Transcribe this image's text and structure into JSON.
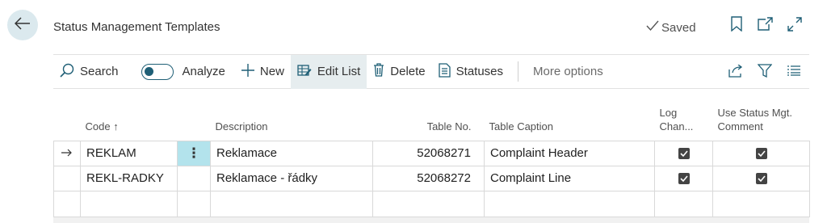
{
  "header": {
    "title": "Status Management Templates",
    "saved_label": "Saved"
  },
  "toolbar": {
    "search_label": "Search",
    "analyze_label": "Analyze",
    "analyze_on": false,
    "new_label": "New",
    "edit_list_label": "Edit List",
    "delete_label": "Delete",
    "statuses_label": "Statuses",
    "more_options_label": "More options"
  },
  "table": {
    "columns": {
      "code": "Code",
      "description": "Description",
      "table_no": "Table No.",
      "table_caption": "Table Caption",
      "log_changes": "Log Chan...",
      "use_status_1": "Use Status Mgt.",
      "use_status_2": "Comment"
    },
    "sort_indicator": "↑",
    "rows": [
      {
        "code": "REKLAM",
        "description": "Reklamace",
        "table_no": "52068271",
        "table_caption": "Complaint Header",
        "log_changes": true,
        "use_status_comment": true,
        "selected": true
      },
      {
        "code": "REKL-RADKY",
        "description": "Reklamace - řádky",
        "table_no": "52068272",
        "table_caption": "Complaint Line",
        "log_changes": true,
        "use_status_comment": true,
        "selected": false
      }
    ]
  },
  "colors": {
    "accent": "#1f5f76",
    "selected_cell": "#b3e3ec",
    "active_tool": "#e6edef"
  },
  "icons": [
    "back-arrow-icon",
    "check-icon",
    "bookmark-icon",
    "open-new-window-icon",
    "expand-icon",
    "search-icon",
    "plus-icon",
    "edit-list-icon",
    "trash-icon",
    "statuses-icon",
    "share-icon",
    "filter-icon",
    "list-view-icon",
    "row-arrow-icon",
    "ellipsis-vertical-icon",
    "checkbox-checked-icon"
  ]
}
